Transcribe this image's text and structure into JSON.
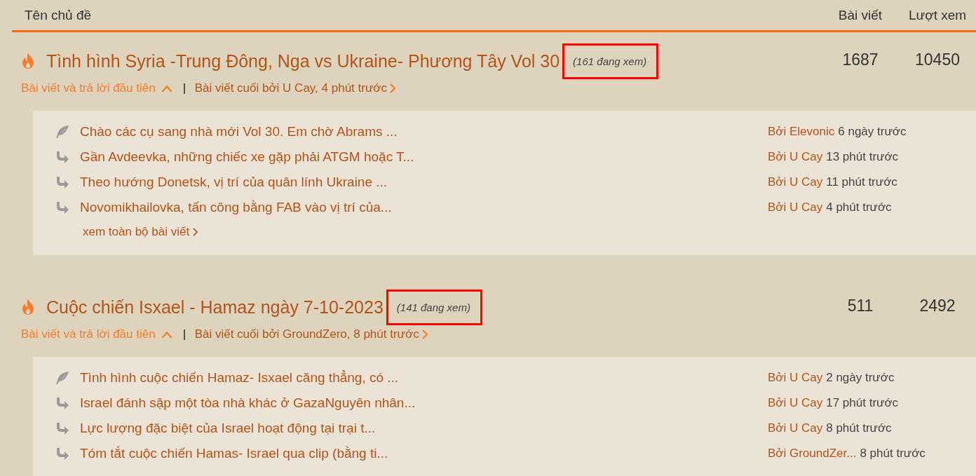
{
  "header": {
    "topic": "Tên chủ đề",
    "posts": "Bài viết",
    "views": "Lượt xem"
  },
  "topics": [
    {
      "title": "Tình hình Syria -Trung Đông, Nga vs Ukraine- Phương Tây Vol 30",
      "viewing": "(161 đang xem)",
      "highlighted": true,
      "posts": "1687",
      "views": "10450",
      "first_link": "Bài viết và trả lời đầu tiên",
      "last_post": "Bài viết cuối bởi U Cay, 4 phút trước",
      "expanded": true,
      "items": [
        {
          "kind": "first",
          "text": "Chào các cụ sang nhà mới Vol 30. Em chờ Abrams ...",
          "author": "Bởi Elevonic",
          "time": "6 ngày trước"
        },
        {
          "kind": "reply",
          "text": "Gần Avdeevka, những chiếc xe gặp phải ATGM hoặc T...",
          "author": "Bởi U Cay",
          "time": "13 phút trước"
        },
        {
          "kind": "reply",
          "text": "Theo hướng Donetsk, vị trí của quân lính Ukraine ...",
          "author": "Bởi U Cay",
          "time": "11 phút trước"
        },
        {
          "kind": "reply",
          "text": "Novomikhailovka, tấn công bằng FAB vào vị trí của...",
          "author": "Bởi U Cay",
          "time": "4 phút trước"
        }
      ],
      "more": "xem toàn bộ bài viết"
    },
    {
      "title": "Cuộc chiến Isxael - Hamaz ngày 7-10-2023",
      "viewing": "(141 đang xem)",
      "highlighted": true,
      "posts": "511",
      "views": "2492",
      "first_link": "Bài viết và trả lời đầu tiên",
      "last_post": "Bài viết cuối bởi GroundZero, 8 phút trước",
      "expanded": true,
      "items": [
        {
          "kind": "first",
          "text": "Tình hình cuộc chiến Hamaz- Isxael căng thẳng, có ...",
          "author": "Bởi U Cay",
          "time": "2 ngày trước"
        },
        {
          "kind": "reply",
          "text": "Israel đánh sập một tòa nhà khác ở GazaNguyên nhân...",
          "author": "Bởi U Cay",
          "time": "17 phút trước"
        },
        {
          "kind": "reply",
          "text": "Lực lượng đặc biệt của Israel hoạt động tại trại t...",
          "author": "Bởi U Cay",
          "time": "8 phút trước"
        },
        {
          "kind": "reply",
          "text": "Tóm tắt cuộc chiến Hamas- Israel qua clip (bằng ti...",
          "author": "Bởi GroundZer...",
          "time": "8 phút trước"
        }
      ]
    }
  ]
}
